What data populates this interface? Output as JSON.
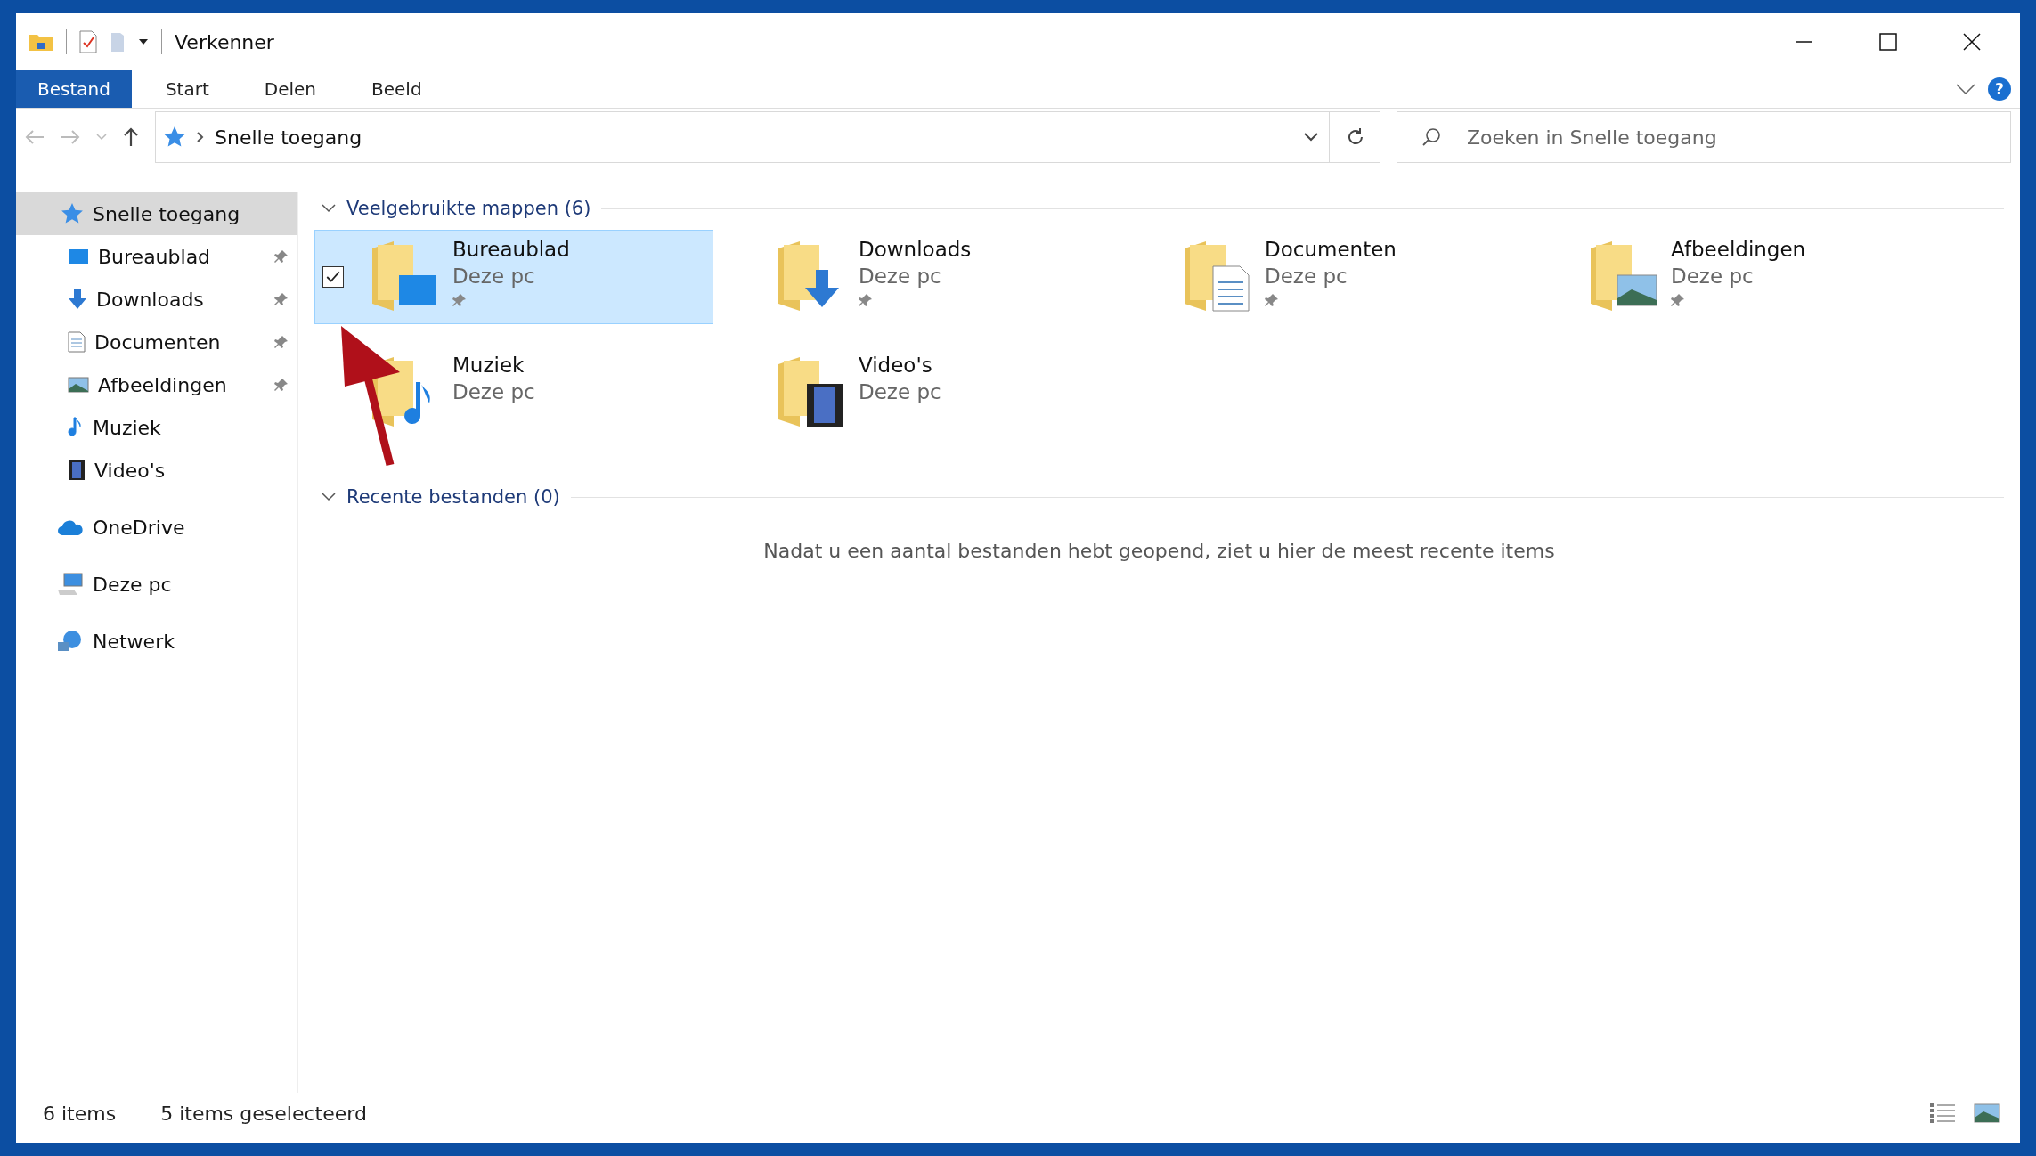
{
  "window": {
    "title": "Verkenner",
    "help": "?"
  },
  "ribbon_tabs": [
    {
      "label": "Bestand",
      "selected": true
    },
    {
      "label": "Start",
      "selected": false
    },
    {
      "label": "Delen",
      "selected": false
    },
    {
      "label": "Beeld",
      "selected": false
    }
  ],
  "address_bar": {
    "path": "Snelle toegang"
  },
  "search": {
    "placeholder": "Zoeken in Snelle toegang"
  },
  "sidebar": {
    "items": [
      {
        "label": "Snelle toegang",
        "kind": "star",
        "selected": true,
        "children": [
          {
            "label": "Bureaublad",
            "kind": "desktop",
            "pinned": true,
            "selected": false
          },
          {
            "label": "Downloads",
            "kind": "download",
            "pinned": true,
            "selected": false
          },
          {
            "label": "Documenten",
            "kind": "document",
            "pinned": true,
            "selected": false
          },
          {
            "label": "Afbeeldingen",
            "kind": "picture",
            "pinned": true,
            "selected": false
          },
          {
            "label": "Muziek",
            "kind": "music",
            "pinned": false,
            "selected": false
          },
          {
            "label": "Video's",
            "kind": "video",
            "pinned": false,
            "selected": false
          }
        ]
      },
      {
        "label": "OneDrive",
        "kind": "cloud",
        "selected": false
      },
      {
        "label": "Deze pc",
        "kind": "pc",
        "selected": false
      },
      {
        "label": "Netwerk",
        "kind": "network",
        "selected": false
      }
    ]
  },
  "groups": [
    {
      "title": "Veelgebruikte mappen (6)",
      "expanded": true,
      "folders": [
        {
          "name": "Bureaublad",
          "location": "Deze pc",
          "kind": "desktop",
          "pinned": true,
          "selected": true
        },
        {
          "name": "Downloads",
          "location": "Deze pc",
          "kind": "download",
          "pinned": true,
          "selected": false
        },
        {
          "name": "Documenten",
          "location": "Deze pc",
          "kind": "document",
          "pinned": true,
          "selected": false
        },
        {
          "name": "Afbeeldingen",
          "location": "Deze pc",
          "kind": "picture",
          "pinned": true,
          "selected": false
        },
        {
          "name": "Muziek",
          "location": "Deze pc",
          "kind": "music",
          "pinned": false,
          "selected": false
        },
        {
          "name": "Video's",
          "location": "Deze pc",
          "kind": "video",
          "pinned": false,
          "selected": false
        }
      ]
    },
    {
      "title": "Recente bestanden (0)",
      "expanded": true,
      "empty_message": "Nadat u een aantal bestanden hebt geopend, ziet u hier de meest recente items"
    }
  ],
  "status_bar": {
    "item_count": "6 items",
    "selection": "5 items geselecteerd"
  }
}
